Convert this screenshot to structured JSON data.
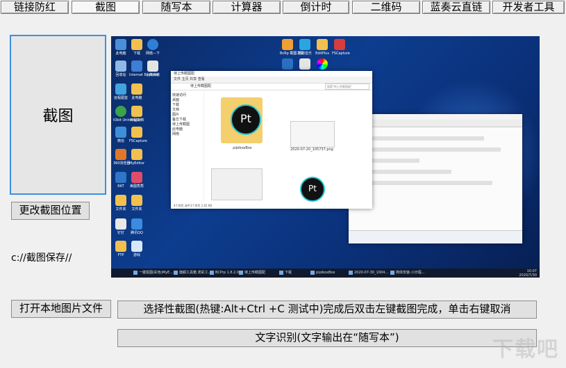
{
  "tabs": [
    {
      "label": "链接防红"
    },
    {
      "label": "截图",
      "active": true
    },
    {
      "label": "随写本"
    },
    {
      "label": "计算器"
    },
    {
      "label": "倒计时"
    },
    {
      "label": "二维码"
    },
    {
      "label": "蓝奏云直链"
    },
    {
      "label": "开发者工具"
    }
  ],
  "left_panel": {
    "capture_label": "截图",
    "change_pos_label": "更改截图位置",
    "save_path": "c://截图保存//"
  },
  "actions": {
    "open_local_label": "打开本地图片文件",
    "select_capture_label": "选择性截图(热键:Alt+Ctrl +C 测试中)完成后双击左键截图完成，单击右键取消",
    "ocr_label": "文字识别(文字输出在“随写本”)"
  },
  "preview": {
    "desktop_icons": [
      "此电脑",
      "下载",
      "网络—下",
      "回收站",
      "Internet Explorer",
      "小熊安装",
      "远程图鉴",
      "此电脑",
      "控制面板",
      "IObit Uninstaller",
      "日程文档",
      "FSCapture",
      "E",
      "微信",
      "图片",
      "文档",
      "RKT",
      "360浏览器",
      "MyEditor",
      "美图秀秀",
      "钉钉",
      "腾讯QQ",
      "文件夹",
      "游戏",
      "FTP"
    ],
    "top_icons": [
      "BcRp 截图工具",
      "酷狗音乐",
      "EditPlus",
      "FSCapture"
    ],
    "explorer": {
      "title": "待上传截图配",
      "tabs": "文件   主页   共享   查看",
      "address": "待上传截图配",
      "search": "搜索\"待上传截图配\"",
      "nav": [
        "快速访问",
        "桌面",
        "下载",
        "文档",
        "图片",
        "备忘下载",
        "待上传截图",
        "此电脑",
        "网络"
      ],
      "files": [
        "pipiboxBox",
        "2020-07-20_105737.png",
        "",
        ""
      ],
      "status": "4个项目  选中1个项目 2.62 KB"
    },
    "taskbar": [
      "一键抠图(彩色)MyE...",
      "旗舰工具箱 虎彩工...",
      "BCPrp 1.8.2.0",
      "待上传截图配",
      "下载",
      "pipiboxBox",
      "2020-07-30_1004...",
      "简体安装-小日程..."
    ],
    "clock_time": "10:07",
    "clock_date": "2020/7/30"
  },
  "watermark_text": "下载吧"
}
